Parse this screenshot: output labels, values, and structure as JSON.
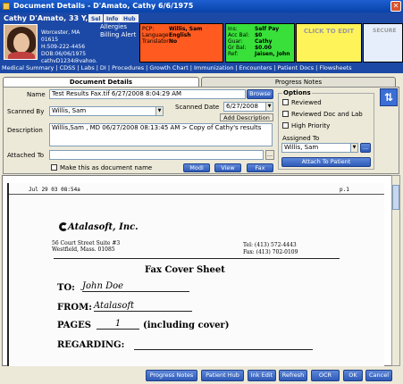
{
  "window": {
    "title": "Document Details - D'Amato, Cathy 6/6/1975"
  },
  "patient": {
    "name": "Cathy D'Amato, 33 Y, F",
    "sel_btn": "Sel",
    "info_btn": "Info",
    "hub_btn": "Hub",
    "address": "Worcester, MA 01615",
    "phone": "H:509-222-4456",
    "dob": "DOB:06/06/1975",
    "email": "cathyD1234@yahoo.",
    "allergies_label": "Allergies",
    "billing_alert": "Billing Alert"
  },
  "red_box": {
    "pcp_k": "PCP:",
    "pcp_v": "Willis, Sam",
    "lang_k": "Language:",
    "lang_v": "English",
    "trans_k": "Translator:",
    "trans_v": "No"
  },
  "green_box": {
    "ins_k": "Ins:",
    "ins_v": "Self Pay",
    "acc_k": "Acc Bal:",
    "acc_v": "$0",
    "guar_k": "Guar:",
    "guar_v": "Cathy",
    "grbal_k": "Gr Bal:",
    "grbal_v": "$0.00",
    "ref_k": "Ref:",
    "ref_v": "Jaisen, John"
  },
  "yellow_box": {
    "label": "CLICK TO EDIT"
  },
  "blue_box": {
    "label": "SECURE"
  },
  "nav": {
    "items": [
      "Medical Summary",
      "CDSS",
      "Labs",
      "DI",
      "Procedures",
      "Growth Chart",
      "Immunization",
      "Encounters",
      "Patient Docs",
      "Flowsheets"
    ]
  },
  "tabs": {
    "document_details": "Document Details",
    "progress_notes": "Progress Notes"
  },
  "form": {
    "name_label": "Name",
    "name_value": "Test Results Fax.tif 6/27/2008 8:04:29 AM",
    "browse_btn": "Browse",
    "scanned_by_label": "Scanned By",
    "scanned_by_value": "Willis, Sam",
    "scanned_date_label": "Scanned Date",
    "scanned_date_value": "6/27/2008",
    "add_description_btn": "Add Description",
    "description_label": "Description",
    "description_value": "Willis,Sam , MD 06/27/2008 08:13:45 AM > Copy of Cathy's results",
    "attached_to_label": "Attached To",
    "make_doc_name_label": "Make this as document name",
    "modi_btn": "Modi",
    "view_btn": "View",
    "fax_btn": "Fax"
  },
  "options": {
    "title": "Options",
    "reviewed": "Reviewed",
    "reviewed_doc_lab": "Reviewed Doc and Lab",
    "high_priority": "High Priority",
    "assigned_to_label": "Assigned To",
    "assigned_to_value": "Willis, Sam",
    "attach_btn": "Attach To Patient"
  },
  "fax": {
    "header_left": "Jul 29 03 08:54a",
    "header_right": "p.1",
    "company": "Atalasoft, Inc.",
    "addr1": "56 Court Street Suite #3",
    "addr2": "Westfield, Mass. 01085",
    "tel": "Tel: (413) 572-4443",
    "fax": "Fax: (413) 702-0109",
    "title": "Fax Cover Sheet",
    "to_label": "TO:",
    "to_value": "John Doe",
    "from_label": "FROM:",
    "from_value": "Atalasoft",
    "pages_label": "PAGES",
    "pages_value": "1",
    "pages_suffix": "(including cover)",
    "regarding_label": "REGARDING:"
  },
  "footer": {
    "progress_notes": "Progress Notes",
    "patient_hub": "Patient Hub",
    "ink_edit": "Ink Edit",
    "refresh": "Refresh",
    "ocr": "OCR",
    "ok": "OK",
    "cancel": "Cancel"
  },
  "colors": {
    "titlebar": "#0842a8",
    "patient_bar": "#1c49a6",
    "red": "#ff5a1f",
    "green": "#39e03a",
    "yellow": "#fff35a"
  }
}
